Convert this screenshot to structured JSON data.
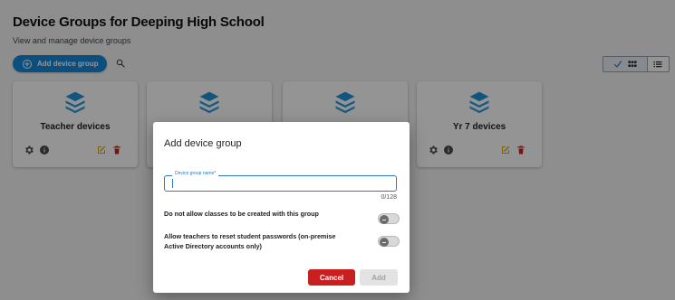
{
  "page": {
    "title": "Device Groups for Deeping High School",
    "subtitle": "View and manage device groups",
    "add_button_label": "Add device group"
  },
  "icons": {
    "search": "search-icon",
    "grid_view": "grid-icon",
    "list_view": "list-icon",
    "check": "check-icon",
    "layers": "layers-icon",
    "settings": "gear-icon",
    "info": "info-icon",
    "edit": "edit-icon",
    "delete": "trash-icon"
  },
  "cards": [
    {
      "title": "Teacher devices"
    },
    {
      "title": ""
    },
    {
      "title": ""
    },
    {
      "title": "Yr 7 devices"
    }
  ],
  "modal": {
    "title": "Add device group",
    "field_label": "Device group name*",
    "field_value": "",
    "counter": "0/128",
    "option1": "Do not allow classes to be created with this group",
    "option2": "Allow teachers to reset student passwords (on-premise Active Directory accounts only)",
    "cancel_label": "Cancel",
    "add_label": "Add"
  },
  "colors": {
    "primary": "#1687d9",
    "danger": "#c91f1f",
    "edit": "#e0a400",
    "icon_dark": "#4a4a4a",
    "layers": "#1f93d9"
  }
}
